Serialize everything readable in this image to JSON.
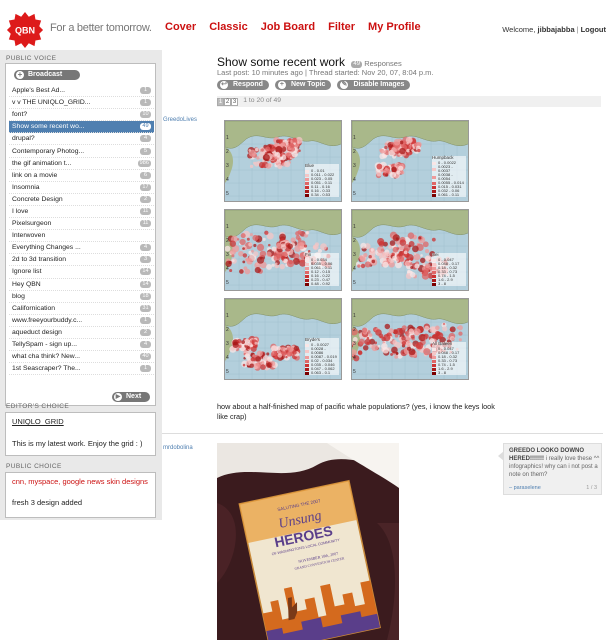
{
  "header": {
    "logo_text": "QBN",
    "tagline": "For a better tomorrow.",
    "nav": [
      {
        "label": "Cover"
      },
      {
        "label": "Classic"
      },
      {
        "label": "Job Board"
      },
      {
        "label": "Filter"
      },
      {
        "label": "My Profile"
      }
    ],
    "welcome": "Welcome,",
    "username": "jibbajabba",
    "logout": "Logout"
  },
  "sidebar": {
    "public_voice": "PUBLIC VOICE",
    "broadcast": "Broadcast",
    "topics": [
      {
        "label": "Apple's Best Ad...",
        "count": "1"
      },
      {
        "label": "v v THE UNIQLO_GRID...",
        "count": "1"
      },
      {
        "label": "font?",
        "count": "10"
      },
      {
        "label": "Show some recent wo...",
        "count": "49",
        "active": true
      },
      {
        "label": "drupal?",
        "count": "4"
      },
      {
        "label": "Contemporary Photog...",
        "count": "5"
      },
      {
        "label": "the gif animation t...",
        "count": "986"
      },
      {
        "label": "link on a movie",
        "count": "6"
      },
      {
        "label": "Insomnia",
        "count": "17"
      },
      {
        "label": "Concrete Design",
        "count": "2"
      },
      {
        "label": "I love",
        "count": "11"
      },
      {
        "label": "Pixelsurgeon",
        "count": "11"
      },
      {
        "label": "Interwoven",
        "count": ""
      },
      {
        "label": "Everything Changes ...",
        "count": "4"
      },
      {
        "label": "2d to 3d transition",
        "count": "3"
      },
      {
        "label": "Ignore list",
        "count": "14"
      },
      {
        "label": "Hey QBN",
        "count": "14"
      },
      {
        "label": "blog",
        "count": "18"
      },
      {
        "label": "Californication",
        "count": "31"
      },
      {
        "label": "www.freeyourbuddy.c...",
        "count": "1"
      },
      {
        "label": "aqueduct design",
        "count": "2"
      },
      {
        "label": "TellySpam - sign up...",
        "count": "4"
      },
      {
        "label": "what cha think? New...",
        "count": "40"
      },
      {
        "label": "1st Seascraper? The...",
        "count": "1"
      }
    ],
    "next": "Next",
    "editors_choice": "EDITOR'S CHOICE",
    "editor_link": "UNIQLO_GRID",
    "editor_text": "This is my latest work. Enjoy the grid : )",
    "public_choice": "PUBLIC CHOICE",
    "public_red": "cnn, myspace, google news skin designs",
    "public_black": "fresh 3 design added"
  },
  "thread": {
    "title": "Show some recent work",
    "responses_count": "49",
    "responses_label": "Responses",
    "meta": "Last post: 10 minutes ago | Thread started: Nov 20, 07, 8:04 p.m.",
    "respond": "Respond",
    "new_topic": "New Topic",
    "disable_images": "Disable Images",
    "pages": [
      "1",
      "2",
      "3"
    ],
    "range": "1 to 20 of 49"
  },
  "posts": [
    {
      "author": "GreedoLives",
      "text": "how about a half-finished map of pacific whale populations? (yes, i know the keys look like crap)",
      "maps": [
        {
          "species": "Blue",
          "legend": [
            "0 - 0.01",
            "0.011 - 0.022",
            "0.023 - 0.05",
            "0.051 - 0.11",
            "0.11 - 0.16",
            "0.16 - 0.33",
            "0.34 - 0.53"
          ]
        },
        {
          "species": "Humpback",
          "legend": [
            "0 - 0.0022",
            "0.0023 - 0.0037",
            "0.0038 - 0.0054",
            "0.0055 - 0.014",
            "0.015 - 0.031",
            "0.032 - 0.06",
            "0.061 - 0.11"
          ]
        },
        {
          "species": "Fin",
          "legend": [
            "0 - 0.034",
            "0.035 - 0.06",
            "0.061 - 0.11",
            "0.12 - 0.15",
            "0.16 - 0.22",
            "0.23 - 0.47",
            "0.48 - 0.92"
          ]
        },
        {
          "species": "Sei",
          "legend": [
            "0 - 0.047",
            "0.048 - 0.17",
            "0.18 - 0.32",
            "0.33 - 0.73",
            "0.74 - 1.5",
            "1.6 - 2.9",
            "3 - 8"
          ]
        },
        {
          "species": "Bryde's",
          "legend": [
            "0 - 0.0027",
            "0.0028 - 0.0086",
            "0.0087 - 0.019",
            "0.02 - 0.034",
            "0.035 - 0.046",
            "0.047 - 0.062",
            "0.063 - 0.1"
          ]
        },
        {
          "species": "All Baleen",
          "legend": [
            "0 - 0.047",
            "0.048 - 0.17",
            "0.18 - 0.32",
            "0.33 - 0.73",
            "0.74 - 1.5",
            "1.6 - 2.9",
            "3 - 8"
          ]
        }
      ]
    },
    {
      "author": "mrdobolina",
      "photo_texts": [
        "SALUTING THE 2007",
        "Unsung",
        "HEROES",
        "OF WASHINGTON'S LOCAL COMMUNITY",
        "NOVEMBER 18th, 2007",
        "GRAND CONVENTION CENTER"
      ],
      "note": {
        "text_bold": "GREEDO LOOKO DOWNO HERED!!!!!!!",
        "text": "i really love these ^^ infographics! why can i not post a note on them?",
        "by": "– paraselene",
        "page": "1 / 3"
      }
    }
  ],
  "colors": {
    "brand_red": "#cc1111",
    "active_blue": "#4f7fb0",
    "sea": "#b3cfdc",
    "land": "#a9b88a"
  }
}
